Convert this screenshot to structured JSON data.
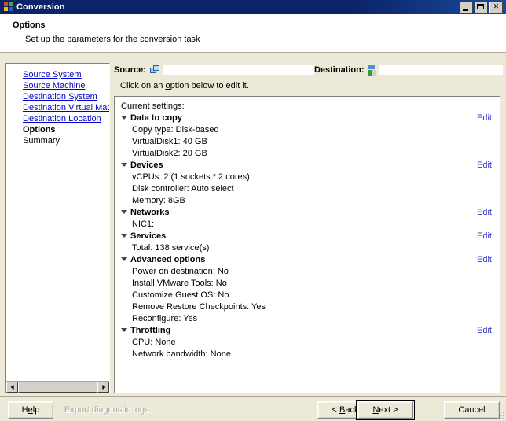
{
  "window": {
    "title": "Conversion",
    "icon": "vmware-converter-icon",
    "controls": {
      "minimize": "minimize-button",
      "maximize": "maximize-button",
      "close": "✕"
    }
  },
  "header": {
    "title": "Options",
    "subtitle": "Set up the parameters for the conversion task"
  },
  "sidebar": {
    "items": [
      {
        "label": "Source System",
        "state": "link"
      },
      {
        "label": "Source Machine",
        "state": "link"
      },
      {
        "label": "Destination System",
        "state": "link"
      },
      {
        "label": "Destination Virtual Machine",
        "state": "link"
      },
      {
        "label": "Destination Location",
        "state": "link"
      },
      {
        "label": "Options",
        "state": "current"
      },
      {
        "label": "Summary",
        "state": "future"
      }
    ]
  },
  "source_destination": {
    "source_label": "Source:",
    "source_value": "",
    "destination_label": "Destination:",
    "destination_value": ""
  },
  "hint": {
    "before": "Click on an ",
    "accel": "o",
    "after": "ption below to edit it."
  },
  "settings": {
    "caption": "Current settings:",
    "edit_label": "Edit",
    "groups": [
      {
        "title": "Data to copy",
        "editable": true,
        "items": [
          "Copy type: Disk-based",
          "VirtualDisk1: 40 GB",
          "VirtualDisk2: 20 GB"
        ]
      },
      {
        "title": "Devices",
        "editable": true,
        "items": [
          "vCPUs: 2 (1 sockets * 2 cores)",
          "Disk controller: Auto select",
          "Memory: 8GB"
        ]
      },
      {
        "title": "Networks",
        "editable": true,
        "items": [
          "NIC1:"
        ]
      },
      {
        "title": "Services",
        "editable": true,
        "items": [
          "Total: 138 service(s)"
        ]
      },
      {
        "title": "Advanced options",
        "editable": true,
        "items": [
          "Power on destination: No",
          "Install VMware Tools: No",
          "Customize Guest OS: No",
          "Remove Restore Checkpoints: Yes",
          "Reconfigure: Yes"
        ]
      },
      {
        "title": "Throttling",
        "editable": true,
        "items": [
          "CPU: None",
          "Network bandwidth: None"
        ]
      }
    ]
  },
  "footer": {
    "help": "Help",
    "help_accel": "e",
    "export_logs": "Export diagnostic logs...",
    "back": "< Back",
    "back_accel": "B",
    "next": "Next >",
    "next_accel": "N",
    "cancel": "Cancel"
  },
  "colors": {
    "titlebar": "#0a246a",
    "link": "#0000cc",
    "edit_link": "#3333cc",
    "dialog_face": "#ece9d8",
    "disabled_text": "#aca899"
  }
}
